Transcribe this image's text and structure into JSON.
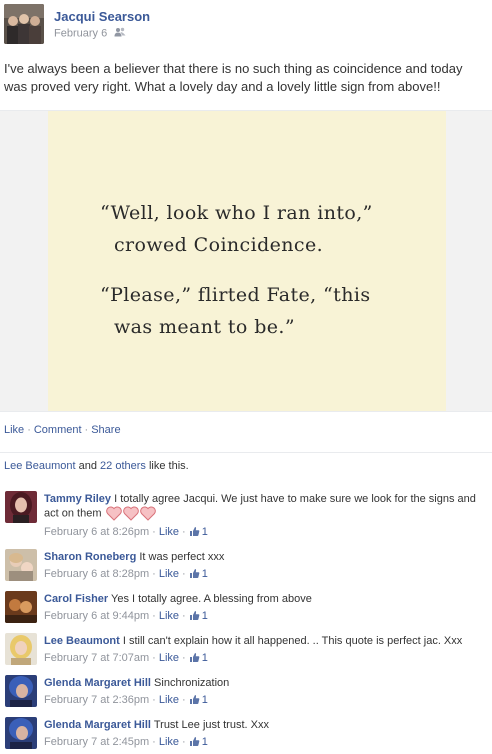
{
  "post": {
    "author": "Jacqui Searson",
    "date": "February 6",
    "audience_icon": "friends-icon",
    "text": "I've always been a believer that there is no such thing as coincidence and today was proved very right. What a lovely day and a lovely little sign from above!!",
    "image_quote": {
      "line1": "“Well, look who I ran into,”",
      "line2": "crowed Coincidence.",
      "line3": "“Please,” flirted Fate, “this",
      "line4": "was meant to be.”"
    }
  },
  "actions": {
    "like": "Like",
    "comment": "Comment",
    "share": "Share",
    "separator": "·"
  },
  "likes_summary": {
    "first_name": "Lee Beaumont",
    "and": " and ",
    "others": "22 others",
    "suffix": " like this."
  },
  "comments": [
    {
      "author": "Tammy Riley",
      "text": "I totally agree Jacqui. We just have to make sure we look for the signs and act on them",
      "hearts": 3,
      "time": "February 6 at 8:26pm",
      "like_label": "Like",
      "likes": "1"
    },
    {
      "author": "Sharon Roneberg",
      "text": "It was perfect xxx",
      "time": "February 6 at 8:28pm",
      "like_label": "Like",
      "likes": "1"
    },
    {
      "author": "Carol Fisher",
      "text": "Yes I totally agree. A blessing from above",
      "time": "February 6 at 9:44pm",
      "like_label": "Like",
      "likes": "1"
    },
    {
      "author": "Lee Beaumont",
      "text": "I still can't explain how it all happened. .. This quote is perfect jac. Xxx",
      "time": "February 7 at 7:07am",
      "like_label": "Like",
      "likes": "1"
    },
    {
      "author": "Glenda Margaret Hill",
      "text": "Sinchronization",
      "time": "February 7 at 2:36pm",
      "like_label": "Like",
      "likes": "1"
    },
    {
      "author": "Glenda Margaret Hill",
      "text": "Trust Lee just trust. Xxx",
      "time": "February 7 at 2:45pm",
      "like_label": "Like",
      "likes": "1"
    }
  ],
  "colors": {
    "link": "#3b5998",
    "meta": "#90949c",
    "card": "#f8f3d6"
  }
}
